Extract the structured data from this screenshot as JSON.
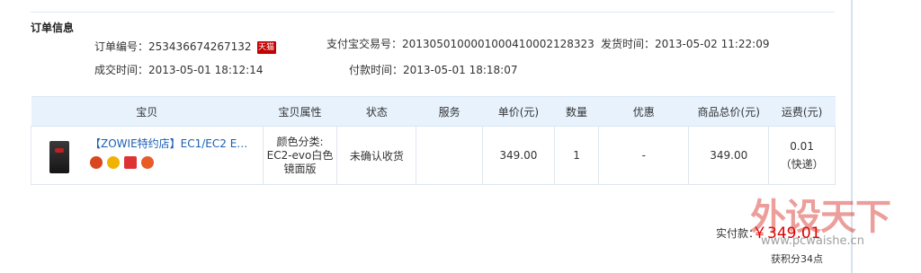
{
  "section_title": "订单信息",
  "order": {
    "order_no_label": "订单编号：",
    "order_no": "253436674267132",
    "tmall_badge": "天猫",
    "alipay_no_label": "支付宝交易号：",
    "alipay_no": "2013050100001000410002128323",
    "ship_time_label": "发货时间：",
    "ship_time": "2013-05-02 11:22:09",
    "deal_time_label": "成交时间：",
    "deal_time": "2013-05-01 18:12:14",
    "pay_time_label": "付款时间：",
    "pay_time": "2013-05-01 18:18:07"
  },
  "table": {
    "headers": [
      "宝贝",
      "宝贝属性",
      "状态",
      "服务",
      "单价(元)",
      "数量",
      "优惠",
      "商品总价(元)",
      "运费(元)"
    ],
    "row": {
      "title": "【ZOWIE特约店】EC1/EC2 EV...",
      "props_line1": "颜色分类:",
      "props_line2": "EC2-evo白色",
      "props_line3": "镜面版",
      "status": "未确认收货",
      "service": "",
      "unit_price": "349.00",
      "quantity": "1",
      "discount": "-",
      "total": "349.00",
      "shipping": "0.01",
      "shipping_method": "（快递）",
      "icons": [
        "seven-day-return-icon",
        "gold-icon",
        "invoice-icon",
        "genuine-icon"
      ]
    }
  },
  "summary": {
    "paid_label": "实付款：",
    "paid_amount": "￥349.01",
    "points": "获积分34点"
  },
  "watermark": {
    "text": "外设天下",
    "url": "www.pcwaishe.cn"
  }
}
